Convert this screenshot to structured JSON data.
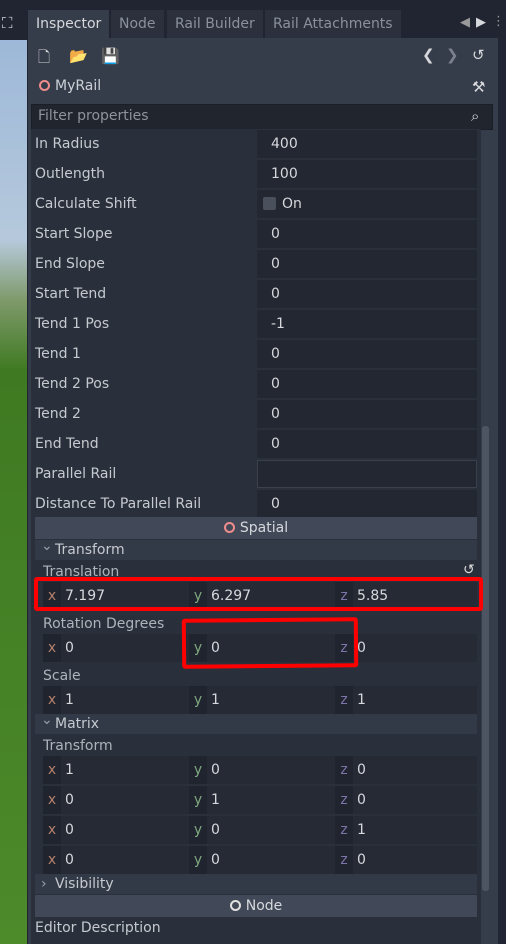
{
  "tabs": [
    "Inspector",
    "Node",
    "Rail Builder",
    "Rail Attachments"
  ],
  "toolbar": {
    "icons": [
      "new-resource-icon",
      "open-folder-icon",
      "save-icon",
      "back-icon",
      "forward-icon",
      "history-icon"
    ]
  },
  "object": {
    "name": "MyRail",
    "icon": "node-circle-icon"
  },
  "filter": {
    "placeholder": "Filter properties"
  },
  "properties": [
    {
      "label": "In Radius",
      "value": "400"
    },
    {
      "label": "Outlength",
      "value": "100"
    },
    {
      "label": "Calculate Shift",
      "value": "On",
      "checkbox": true,
      "checked": false
    },
    {
      "label": "Start Slope",
      "value": "0"
    },
    {
      "label": "End Slope",
      "value": "0"
    },
    {
      "label": "Start Tend",
      "value": "0"
    },
    {
      "label": "Tend 1 Pos",
      "value": "-1"
    },
    {
      "label": "Tend 1",
      "value": "0"
    },
    {
      "label": "Tend 2 Pos",
      "value": "0"
    },
    {
      "label": "Tend 2",
      "value": "0"
    },
    {
      "label": "End Tend",
      "value": "0"
    },
    {
      "label": "Parallel Rail",
      "value": ""
    },
    {
      "label": "Distance To Parallel Rail",
      "value": "0"
    }
  ],
  "spatial": {
    "title": "Spatial",
    "transform": {
      "title": "Transform",
      "translation": {
        "label": "Translation",
        "x": "7.197",
        "y": "6.297",
        "z": "5.85"
      },
      "rotation": {
        "label": "Rotation Degrees",
        "x": "0",
        "y": "0",
        "z": "0"
      },
      "scale": {
        "label": "Scale",
        "x": "1",
        "y": "1",
        "z": "1"
      }
    },
    "matrix": {
      "title": "Matrix",
      "transform_label": "Transform",
      "rows": [
        {
          "x": "1",
          "y": "0",
          "z": "0"
        },
        {
          "x": "0",
          "y": "1",
          "z": "0"
        },
        {
          "x": "0",
          "y": "0",
          "z": "1"
        },
        {
          "x": "0",
          "y": "0",
          "z": "0"
        }
      ]
    },
    "visibility": "Visibility"
  },
  "node": {
    "title": "Node",
    "editor_description": "Editor Description"
  },
  "colors": {
    "x": "#b5806c",
    "y": "#7fa77f",
    "z": "#7c74a8",
    "highlight": "#ff0000"
  }
}
